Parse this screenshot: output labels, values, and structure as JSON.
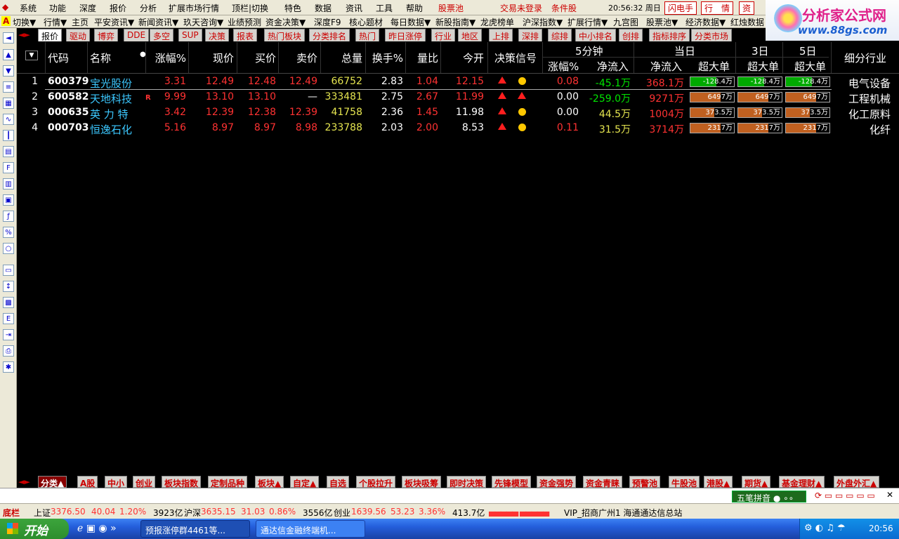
{
  "menu": [
    "系统",
    "功能",
    "深度",
    "报价",
    "分析",
    "扩展市场行情",
    "顶栏|切换",
    "特色",
    "数据",
    "资讯",
    "工具",
    "帮助"
  ],
  "menu_right": {
    "pool": "股票池",
    "login": "交易未登录",
    "cond": "条件股",
    "clock": "20:56:32 周日",
    "flash": "闪电手",
    "quote": "行　情",
    "zi": "资"
  },
  "toolbar": [
    "切换▼",
    "行情▼",
    "主页",
    "平安资讯▼",
    "新闻资讯▼",
    "玖天咨询▼",
    "业绩预测",
    "资金决策▼",
    "深度F9",
    "核心题材",
    "每日数据▼",
    "新股指南▼",
    "龙虎榜单",
    "沪深指数▼",
    "扩展行情▼",
    "九宫图",
    "股票池▼",
    "经济数据▼",
    "红烛数据"
  ],
  "logo": {
    "title": "分析家公式网",
    "url": "www.88gs.com"
  },
  "tabs": [
    "报价",
    "驱动",
    "博弈",
    "DDE",
    "多空",
    "SUP",
    "决策",
    "报表",
    "热门板块",
    "分类排名",
    "热门",
    "昨日涨停",
    "行业",
    "地区",
    "上排",
    "深排",
    "综排",
    "中小排名",
    "创排",
    "指标排序",
    "分类市场"
  ],
  "headers": {
    "code": "代码",
    "name": "名称",
    "pct": "涨幅%",
    "price": "现价",
    "bid": "买价",
    "ask": "卖价",
    "vol": "总量",
    "turn": "换手%",
    "ratio": "量比",
    "open": "今开",
    "signal": "决策信号",
    "m5": "5分钟",
    "today": "当日",
    "d3": "3日",
    "d5": "5日",
    "m5pct": "涨幅%",
    "m5flow": "净流入",
    "tflow": "净流入",
    "big": "超大单",
    "big3": "超大单",
    "big5": "超大单",
    "industry": "细分行业"
  },
  "rows": [
    {
      "idx": "1",
      "code": "600379",
      "name": "宝光股份",
      "flag": "",
      "pct": "3.31",
      "price": "12.49",
      "bid": "12.48",
      "ask": "12.49",
      "vol": "66752",
      "turn": "2.83",
      "ratio": "1.04",
      "open": "12.15",
      "m5pct": "0.08",
      "m5flow": "-45.1万",
      "tflow": "368.1万",
      "big": "-128.4万",
      "big3": "-128.4万",
      "big5": "-128.4万",
      "industry": "电气设备"
    },
    {
      "idx": "2",
      "code": "600582",
      "name": "天地科技",
      "flag": "R",
      "pct": "9.99",
      "price": "13.10",
      "bid": "13.10",
      "ask": "—",
      "vol": "333481",
      "turn": "2.75",
      "ratio": "2.67",
      "open": "11.99",
      "m5pct": "0.00",
      "m5flow": "-259.0万",
      "tflow": "9271万",
      "big": "6497万",
      "big3": "6497万",
      "big5": "6497万",
      "industry": "工程机械"
    },
    {
      "idx": "3",
      "code": "000635",
      "name": "英 力 特",
      "flag": "",
      "pct": "3.42",
      "price": "12.39",
      "bid": "12.38",
      "ask": "12.39",
      "vol": "41758",
      "turn": "2.36",
      "ratio": "1.45",
      "open": "11.98",
      "m5pct": "0.00",
      "m5flow": "44.5万",
      "tflow": "1004万",
      "big": "373.5万",
      "big3": "373.5万",
      "big5": "373.5万",
      "industry": "化工原料"
    },
    {
      "idx": "4",
      "code": "000703",
      "name": "恒逸石化",
      "flag": "",
      "pct": "5.16",
      "price": "8.97",
      "bid": "8.97",
      "ask": "8.98",
      "vol": "233788",
      "turn": "2.03",
      "ratio": "2.00",
      "open": "8.53",
      "m5pct": "0.11",
      "m5flow": "31.5万",
      "tflow": "3714万",
      "big": "2317万",
      "big3": "2317万",
      "big5": "2317万",
      "industry": "化纤"
    }
  ],
  "bottom_tabs": [
    "分类▲",
    "A股",
    "中小",
    "创业",
    "板块指数",
    "定制品种",
    "板块▲",
    "自定▲",
    "自选",
    "个股拉升",
    "板块吸筹",
    "即时决策",
    "先锋模型",
    "资金强势",
    "资金青睐",
    "预警池",
    "牛股池",
    "港股▲",
    "期货▲",
    "基金理财▲",
    "外盘外汇▲"
  ],
  "ime": "五笔拼音",
  "status": {
    "label": "底栏",
    "sh": "上证",
    "sh_val": "3376.50",
    "sh_chg": "40.04",
    "sh_pct": "1.20%",
    "sh_amt": "3923亿",
    "hs": "沪深",
    "hs_val": "3635.15",
    "hs_chg": "31.03",
    "hs_pct": "0.86%",
    "hs_amt": "3556亿",
    "cy": "创业",
    "cy_val": "1639.56",
    "cy_chg": "53.23",
    "cy_pct": "3.36%",
    "cy_amt": "413.7亿",
    "vip": "VIP_招商广州1 海通通达信总站"
  },
  "taskbar": {
    "start": "开始",
    "task1": "预报涨停群4461等...",
    "task2": "通达信金融终端机...",
    "time": "20:56"
  }
}
